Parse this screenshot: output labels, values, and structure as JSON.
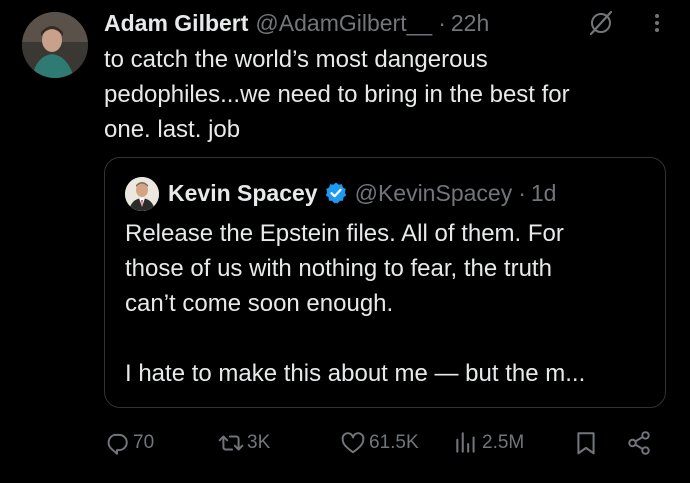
{
  "tweet": {
    "author_name": "Adam Gilbert",
    "author_handle": "@AdamGilbert__",
    "separator": "·",
    "time": "22h",
    "text_lines": [
      "to catch the world’s most dangerous",
      "pedophiles...we need to bring in the best for",
      "one. last. job"
    ]
  },
  "quote": {
    "author_name": "Kevin Spacey",
    "author_handle": "@KevinSpacey",
    "separator": "·",
    "time": "1d",
    "text_lines": [
      "Release the Epstein files. All of them. For",
      "those of us with nothing to fear, the truth",
      "can’t come soon enough."
    ],
    "text_line_last": "I hate to make this about me — but the m..."
  },
  "actions": {
    "replies": "70",
    "reposts": "3K",
    "likes": "61.5K",
    "views": "2.5M"
  },
  "colors": {
    "background": "#000000",
    "text": "#e7e9ea",
    "secondary": "#71767b",
    "border": "#2f3336",
    "verified": "#1d9bf0"
  },
  "icons": [
    "grok-icon",
    "more-icon",
    "verified-badge-icon",
    "reply-icon",
    "repost-icon",
    "like-icon",
    "views-icon",
    "bookmark-icon",
    "share-icon"
  ]
}
